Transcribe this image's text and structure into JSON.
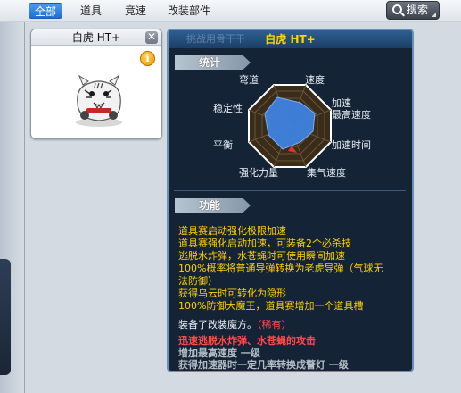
{
  "tabs": [
    {
      "label": "全部",
      "active": true
    },
    {
      "label": "道具",
      "active": false
    },
    {
      "label": "竞速",
      "active": false
    },
    {
      "label": "改装部件",
      "active": false
    }
  ],
  "search": {
    "label": "搜索",
    "icon": "search-icon"
  },
  "card": {
    "title": "白虎 HT+",
    "close_icon": "close-icon",
    "info_icon": "i",
    "image": "white-tiger-kart-image"
  },
  "panel": {
    "title": "白虎 HT+",
    "ghost_text": "挑战用骨干干"
  },
  "stats": {
    "section_label": "统计",
    "labels": {
      "top_left": "弯道",
      "top_right": "速度",
      "accel": "加速",
      "max_speed": "最高速度",
      "stability": "稳定性",
      "balance": "平衡",
      "accel_time": "加速时间",
      "boost_power": "强化力量",
      "charge_speed": "集气速度"
    }
  },
  "functions": {
    "section_label": "功能",
    "lines": [
      "道具赛启动强化极限加速",
      "道具赛强化启动加速，可装备2个必杀技",
      "逃脱水炸弹，水苍蝇时可使用瞬间加速",
      "100%概率将普通导弹转换为老虎导弹（气球无",
      "法防御）",
      "获得乌云时可转化为隐形",
      "100%防御大魔王，道具赛增加一个道具槽"
    ]
  },
  "equip": {
    "text": "装备了改装魔方。",
    "rarity": "（稀有）",
    "attack": "迅速逃脱水炸弹、水苍蝇的攻击",
    "extra1": "增加最高速度 一级",
    "extra2": "获得加速器时一定几率转换成警灯 一级"
  },
  "colors": {
    "accent": "#1f6fd2",
    "panel_bg": "#142335",
    "func_text": "#ffd200",
    "rare_text": "#ff4a4a"
  }
}
